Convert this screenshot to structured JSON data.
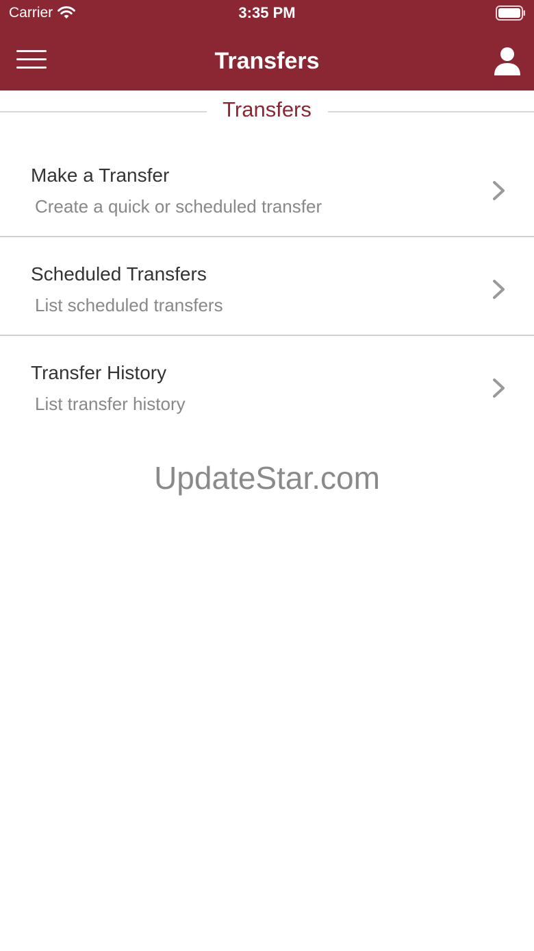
{
  "status_bar": {
    "carrier": "Carrier",
    "time": "3:35 PM",
    "icons": [
      "wifi-icon",
      "battery-icon"
    ]
  },
  "nav": {
    "title": "Transfers",
    "menu_icon": "hamburger-menu-icon",
    "profile_icon": "user-profile-icon"
  },
  "section": {
    "title": "Transfers"
  },
  "items": [
    {
      "title": "Make a Transfer",
      "subtitle": "Create a quick or scheduled transfer",
      "icon": "chevron-right-icon"
    },
    {
      "title": "Scheduled Transfers",
      "subtitle": "List scheduled transfers",
      "icon": "chevron-right-icon"
    },
    {
      "title": "Transfer History",
      "subtitle": "List transfer history",
      "icon": "chevron-right-icon"
    }
  ],
  "watermark": "UpdateStar.com",
  "colors": {
    "brand": "#8b2633",
    "title_text": "#333333",
    "subtitle_text": "#888888",
    "chevron": "#9a9a9a",
    "divider": "#d0d0d0"
  }
}
